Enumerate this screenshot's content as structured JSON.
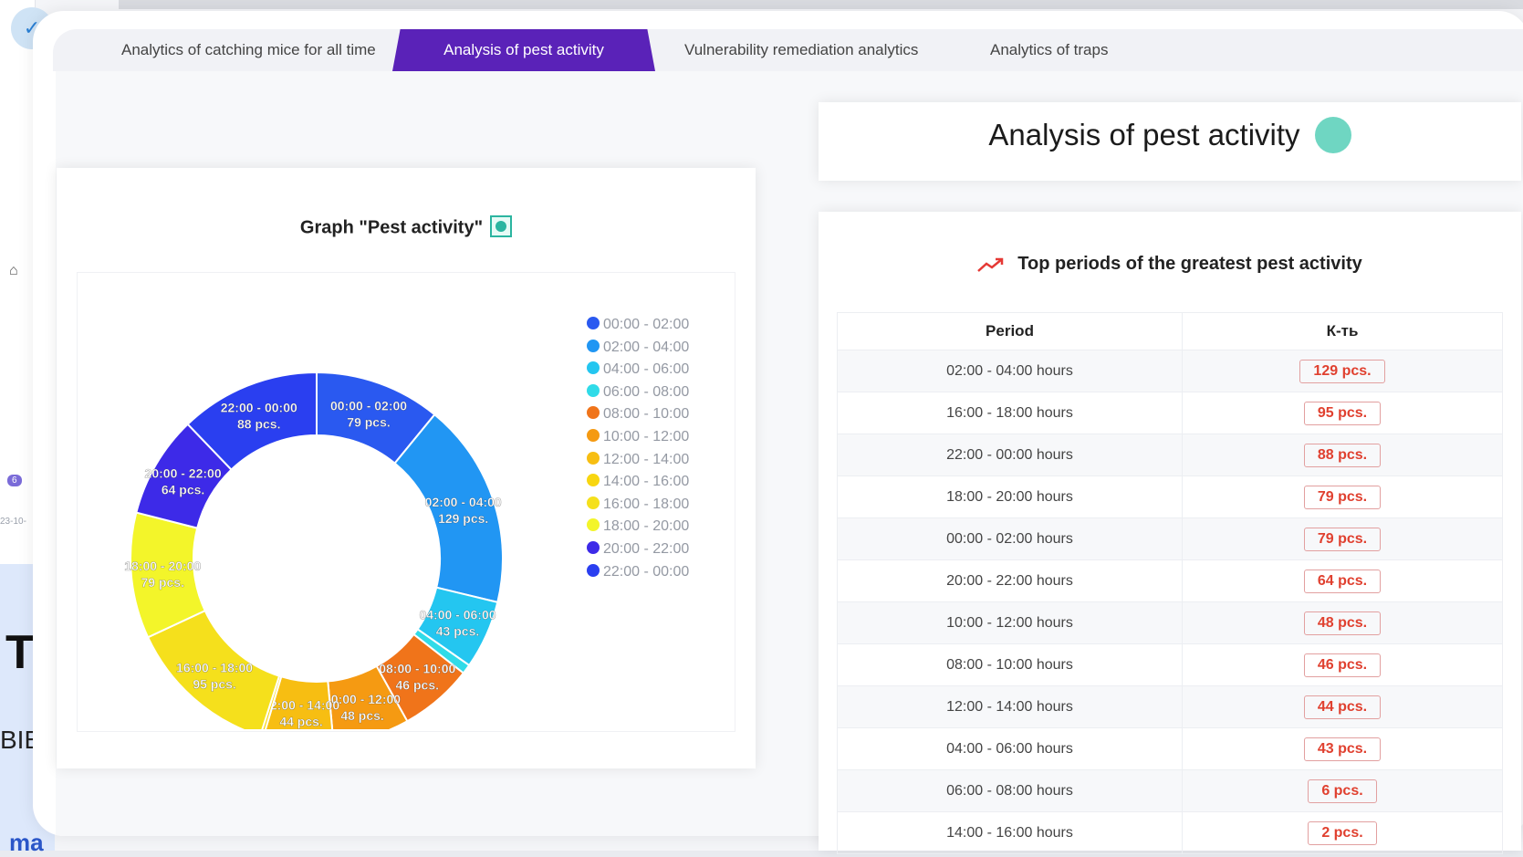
{
  "tabs": [
    {
      "label": "Analytics of catching mice for all time"
    },
    {
      "label": "Analysis of pest activity"
    },
    {
      "label": "Vulnerability remediation analytics"
    },
    {
      "label": "Analytics of traps"
    }
  ],
  "header": {
    "title": "Analysis of pest activity",
    "status_color": "#6fd6c2"
  },
  "chart": {
    "title": "Graph \"Pest activity\""
  },
  "chart_data": {
    "type": "pie",
    "donut": true,
    "legend_position": "right",
    "slices": [
      {
        "label": "00:00 - 02:00",
        "value": 79,
        "unit": "pcs.",
        "color": "#2a59f0"
      },
      {
        "label": "02:00 - 04:00",
        "value": 129,
        "unit": "pcs.",
        "color": "#2196f3"
      },
      {
        "label": "04:00 - 06:00",
        "value": 43,
        "unit": "pcs.",
        "color": "#24c6f0"
      },
      {
        "label": "06:00 - 08:00",
        "value": 6,
        "unit": "pcs.",
        "color": "#30dbe8"
      },
      {
        "label": "08:00 - 10:00",
        "value": 46,
        "unit": "pcs.",
        "color": "#f0741a"
      },
      {
        "label": "10:00 - 12:00",
        "value": 48,
        "unit": "pcs.",
        "color": "#f59a12"
      },
      {
        "label": "12:00 - 14:00",
        "value": 44,
        "unit": "pcs.",
        "color": "#f7be12"
      },
      {
        "label": "14:00 - 16:00",
        "value": 2,
        "unit": "pcs.",
        "color": "#f8d610"
      },
      {
        "label": "16:00 - 18:00",
        "value": 95,
        "unit": "pcs.",
        "color": "#f5e01c"
      },
      {
        "label": "18:00 - 20:00",
        "value": 79,
        "unit": "pcs.",
        "color": "#f3f52a"
      },
      {
        "label": "20:00 - 22:00",
        "value": 64,
        "unit": "pcs.",
        "color": "#3d2ae8"
      },
      {
        "label": "22:00 - 00:00",
        "value": 88,
        "unit": "pcs.",
        "color": "#2a3ff0"
      }
    ]
  },
  "top_periods": {
    "title": "Top periods of the greatest pest activity",
    "headers": [
      "Period",
      "К-ть"
    ],
    "rows": [
      {
        "period": "02:00 - 04:00 hours",
        "count": "129 pcs."
      },
      {
        "period": "16:00 - 18:00 hours",
        "count": "95 pcs."
      },
      {
        "period": "22:00 - 00:00 hours",
        "count": "88 pcs."
      },
      {
        "period": "18:00 - 20:00 hours",
        "count": "79 pcs."
      },
      {
        "period": "00:00 - 02:00 hours",
        "count": "79 pcs."
      },
      {
        "period": "20:00 - 22:00 hours",
        "count": "64 pcs."
      },
      {
        "period": "10:00 - 12:00 hours",
        "count": "48 pcs."
      },
      {
        "period": "08:00 - 10:00 hours",
        "count": "46 pcs."
      },
      {
        "period": "12:00 - 14:00 hours",
        "count": "44 pcs."
      },
      {
        "period": "04:00 - 06:00 hours",
        "count": "43 pcs."
      },
      {
        "period": "06:00 - 08:00 hours",
        "count": "6 pcs."
      },
      {
        "period": "14:00 - 16:00 hours",
        "count": "2 pcs."
      }
    ]
  },
  "background": {
    "badge": "6",
    "date_fragment": "23-10-",
    "big_letter": "T",
    "text_fragment": "BIE",
    "link_fragment": "ma"
  }
}
